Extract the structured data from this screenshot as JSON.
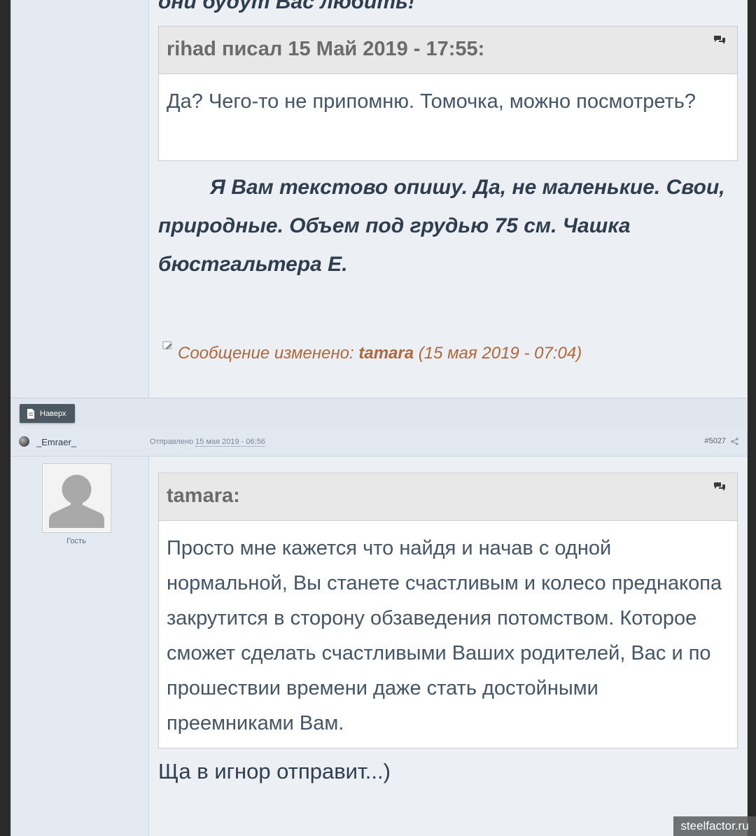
{
  "post1": {
    "top_text": "они будут Вас любить!",
    "quote": {
      "cite": "rihad писал 15 Май 2019 - 17:55:",
      "text": "Да? Чего-то не припомню. Томочка, можно посмотреть?"
    },
    "reply": "Я Вам текстово опишу. Да, не маленькие. Свои, природные. Объем под грудью 75 см. Чашка бюстгальтера Е.",
    "edited": {
      "prefix": "Сообщение изменено: ",
      "user": "tamara",
      "when": " (15 мая 2019 - 07:04)"
    }
  },
  "toolbar": {
    "top_button": "Наверх"
  },
  "post2": {
    "author": "_Emraer_",
    "posted_label": "Отправлено ",
    "posted_date": "15 мая 2019 - 06:56",
    "post_number": "#5027",
    "role": "Гость",
    "quote": {
      "cite": "tamara:",
      "text": "Просто мне кажется что найдя и начав с одной нормальной, Вы станете счастливым и колесо преднакопа закрутится в сторону обзаведения потомством. Которое сможет сделать счастливыми Ваших родителей, Вас и по прошествии времени даже стать достойными преемниками Вам."
    },
    "reply": "Ща в игнор отправит...)"
  },
  "watermark": "steelfactor.ru",
  "colors": {
    "accent_text": "#2f3e4e",
    "edited_text": "#b0683a",
    "button_bg": "#4c5862"
  }
}
